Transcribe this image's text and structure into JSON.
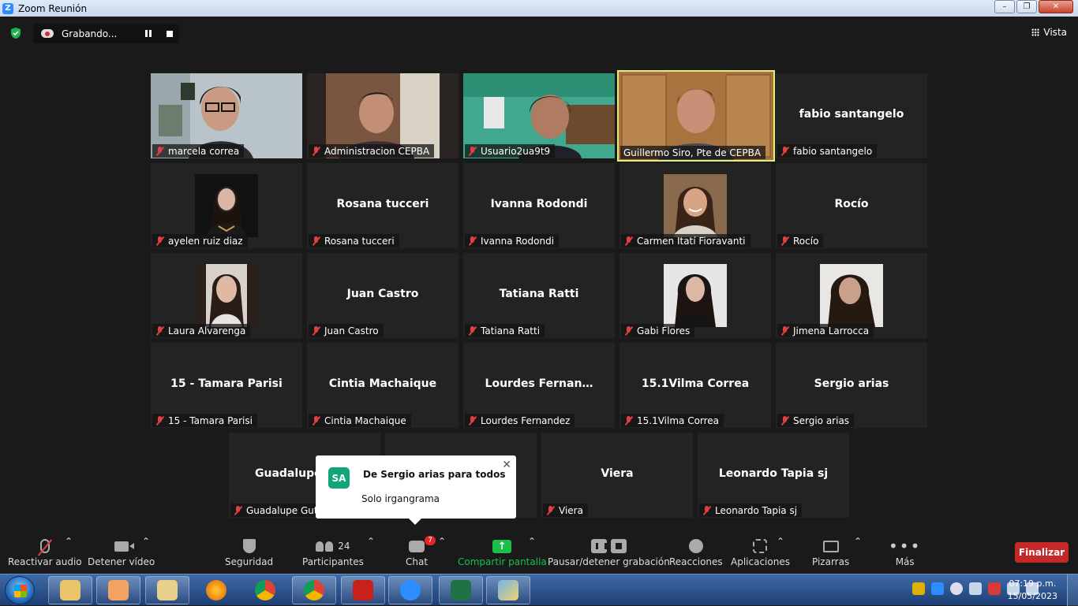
{
  "window": {
    "title": "Zoom Reunión",
    "controls": [
      "–",
      "❐",
      "✕"
    ]
  },
  "topbar": {
    "recording_label": "Grabando...",
    "view_label": "Vista"
  },
  "tiles": [
    {
      "name": "marcela correa",
      "display": "video",
      "active": false
    },
    {
      "name": "Administracion CEPBA",
      "display": "video",
      "active": false
    },
    {
      "name": "Usuario2ua9t9",
      "display": "video",
      "active": false
    },
    {
      "name": "Guillermo Siro, Pte de CEPBA",
      "display": "video",
      "active": true
    },
    {
      "name": "fabio santangelo",
      "display": "name",
      "center": "fabio santangelo"
    },
    {
      "name": "ayelen ruiz diaz",
      "display": "photo"
    },
    {
      "name": "Rosana tucceri",
      "display": "name",
      "center": "Rosana tucceri"
    },
    {
      "name": "Ivanna Rodondi",
      "display": "name",
      "center": "Ivanna Rodondi"
    },
    {
      "name": "Carmen Itatí Fioravanti",
      "display": "photo"
    },
    {
      "name": "Rocío",
      "display": "name",
      "center": "Rocío"
    },
    {
      "name": "Laura Alvarenga",
      "display": "photo"
    },
    {
      "name": "Juan Castro",
      "display": "name",
      "center": "Juan Castro"
    },
    {
      "name": "Tatiana Ratti",
      "display": "name",
      "center": "Tatiana Ratti"
    },
    {
      "name": "Gabi Flores",
      "display": "photo"
    },
    {
      "name": "Jimena Larrocca",
      "display": "photo"
    },
    {
      "name": "15 - Tamara Parisi",
      "display": "name",
      "center": "15 - Tamara Parisi"
    },
    {
      "name": "Cintia Machaique",
      "display": "name",
      "center": "Cintia Machaique"
    },
    {
      "name": "Lourdes Fernandez",
      "display": "name",
      "center": "Lourdes  Fernan…"
    },
    {
      "name": "15.1Vilma Correa",
      "display": "name",
      "center": "15.1Vilma Correa"
    },
    {
      "name": "Sergio arias",
      "display": "name",
      "center": "Sergio arias"
    },
    {
      "name": "Guadalupe Gut",
      "display": "name",
      "center": "Guadalupe"
    },
    {
      "name": "",
      "display": "name",
      "center": ""
    },
    {
      "name": "Viera",
      "display": "name",
      "center": "Viera"
    },
    {
      "name": "Leonardo Tapia sj",
      "display": "name",
      "center": "Leonardo Tapia sj"
    }
  ],
  "chat_popup": {
    "initials": "SA",
    "from": "De Sergio arias para todos",
    "message": "Solo irgangrama",
    "close": "✕"
  },
  "toolbar": {
    "audio": "Reactivar audio",
    "video": "Detener vídeo",
    "security": "Seguridad",
    "participants": "Participantes",
    "participants_count": "24",
    "chat": "Chat",
    "chat_badge": "7",
    "share": "Compartir pantalla",
    "record": "Pausar/detener grabación",
    "reactions": "Reacciones",
    "apps": "Aplicaciones",
    "whiteboards": "Pizarras",
    "more": "Más",
    "end": "Finalizar"
  },
  "taskbar": {
    "apps": [
      "explorer",
      "media",
      "mail",
      "firefox",
      "chrome",
      "chrome-profile",
      "acrobat",
      "zoom",
      "excel",
      "paint"
    ],
    "time": "07:19 p.m.",
    "date": "15/05/2023"
  },
  "colors": {
    "active_border": "#e6ec7a",
    "end_button": "#c52828",
    "share_green": "#1bc04a",
    "chat_avatar": "#10a57a"
  }
}
